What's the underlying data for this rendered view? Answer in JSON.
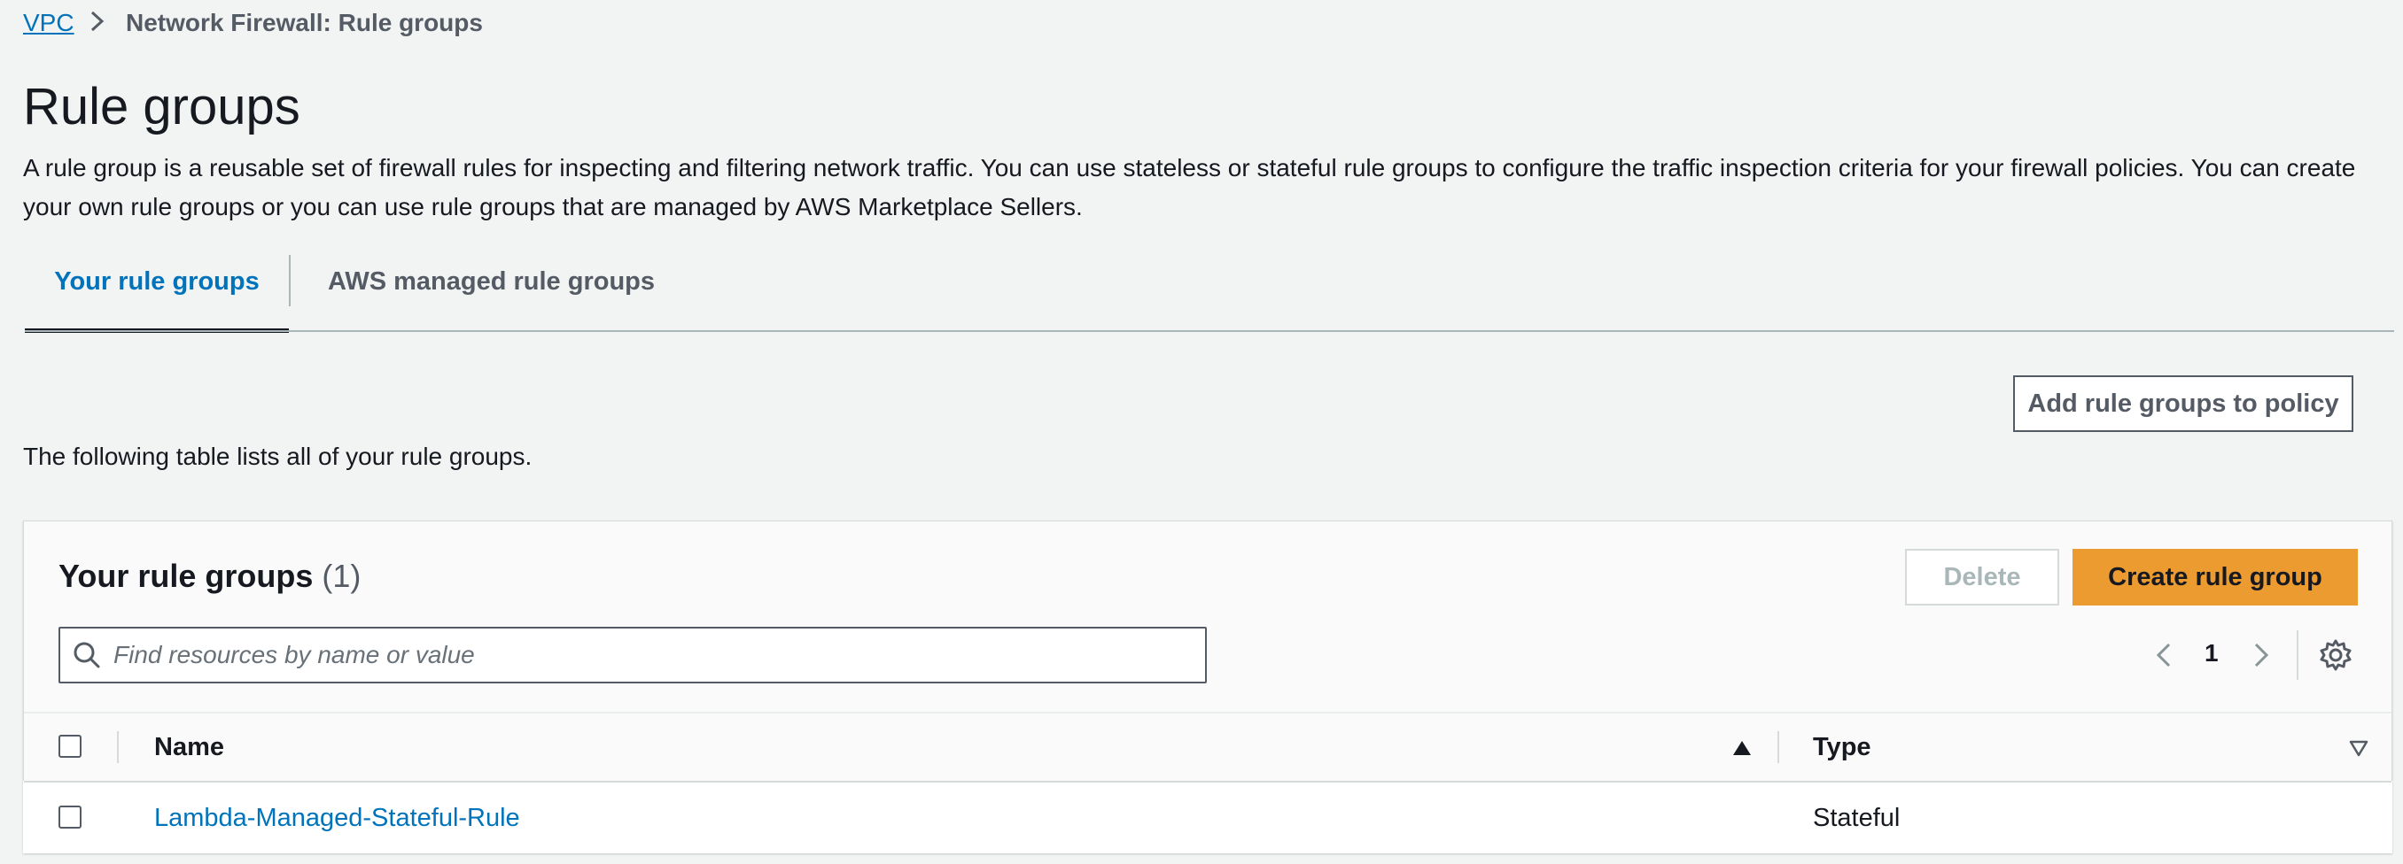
{
  "breadcrumb": {
    "root": "VPC",
    "current": "Network Firewall: Rule groups"
  },
  "page": {
    "title": "Rule groups",
    "description": "A rule group is a reusable set of firewall rules for inspecting and filtering network traffic. You can use stateless or stateful rule groups to configure the traffic inspection criteria for your firewall policies. You can create your own rule groups or you can use rule groups that are managed by AWS Marketplace Sellers."
  },
  "tabs": [
    {
      "label": "Your rule groups",
      "active": true
    },
    {
      "label": "AWS managed rule groups",
      "active": false
    }
  ],
  "actions": {
    "add_to_policy": "Add rule groups to policy"
  },
  "intro_text": "The following table lists all of your rule groups.",
  "table": {
    "title": "Your rule groups",
    "count": "(1)",
    "delete_label": "Delete",
    "create_label": "Create rule group",
    "search_placeholder": "Find resources by name or value",
    "page_number": "1",
    "columns": [
      "Name",
      "Type"
    ],
    "rows": [
      {
        "name": "Lambda-Managed-Stateful-Rule",
        "type": "Stateful"
      }
    ]
  },
  "colors": {
    "link": "#0073bb",
    "primary_button": "#ec9b31",
    "background": "#f2f3f3"
  },
  "icons": {
    "breadcrumb_separator": "chevron-right-icon",
    "search": "search-icon",
    "prev": "chevron-left-icon",
    "next": "chevron-right-icon",
    "settings": "gear-icon",
    "sort_asc": "caret-up-icon",
    "sort_desc": "caret-down-icon"
  }
}
